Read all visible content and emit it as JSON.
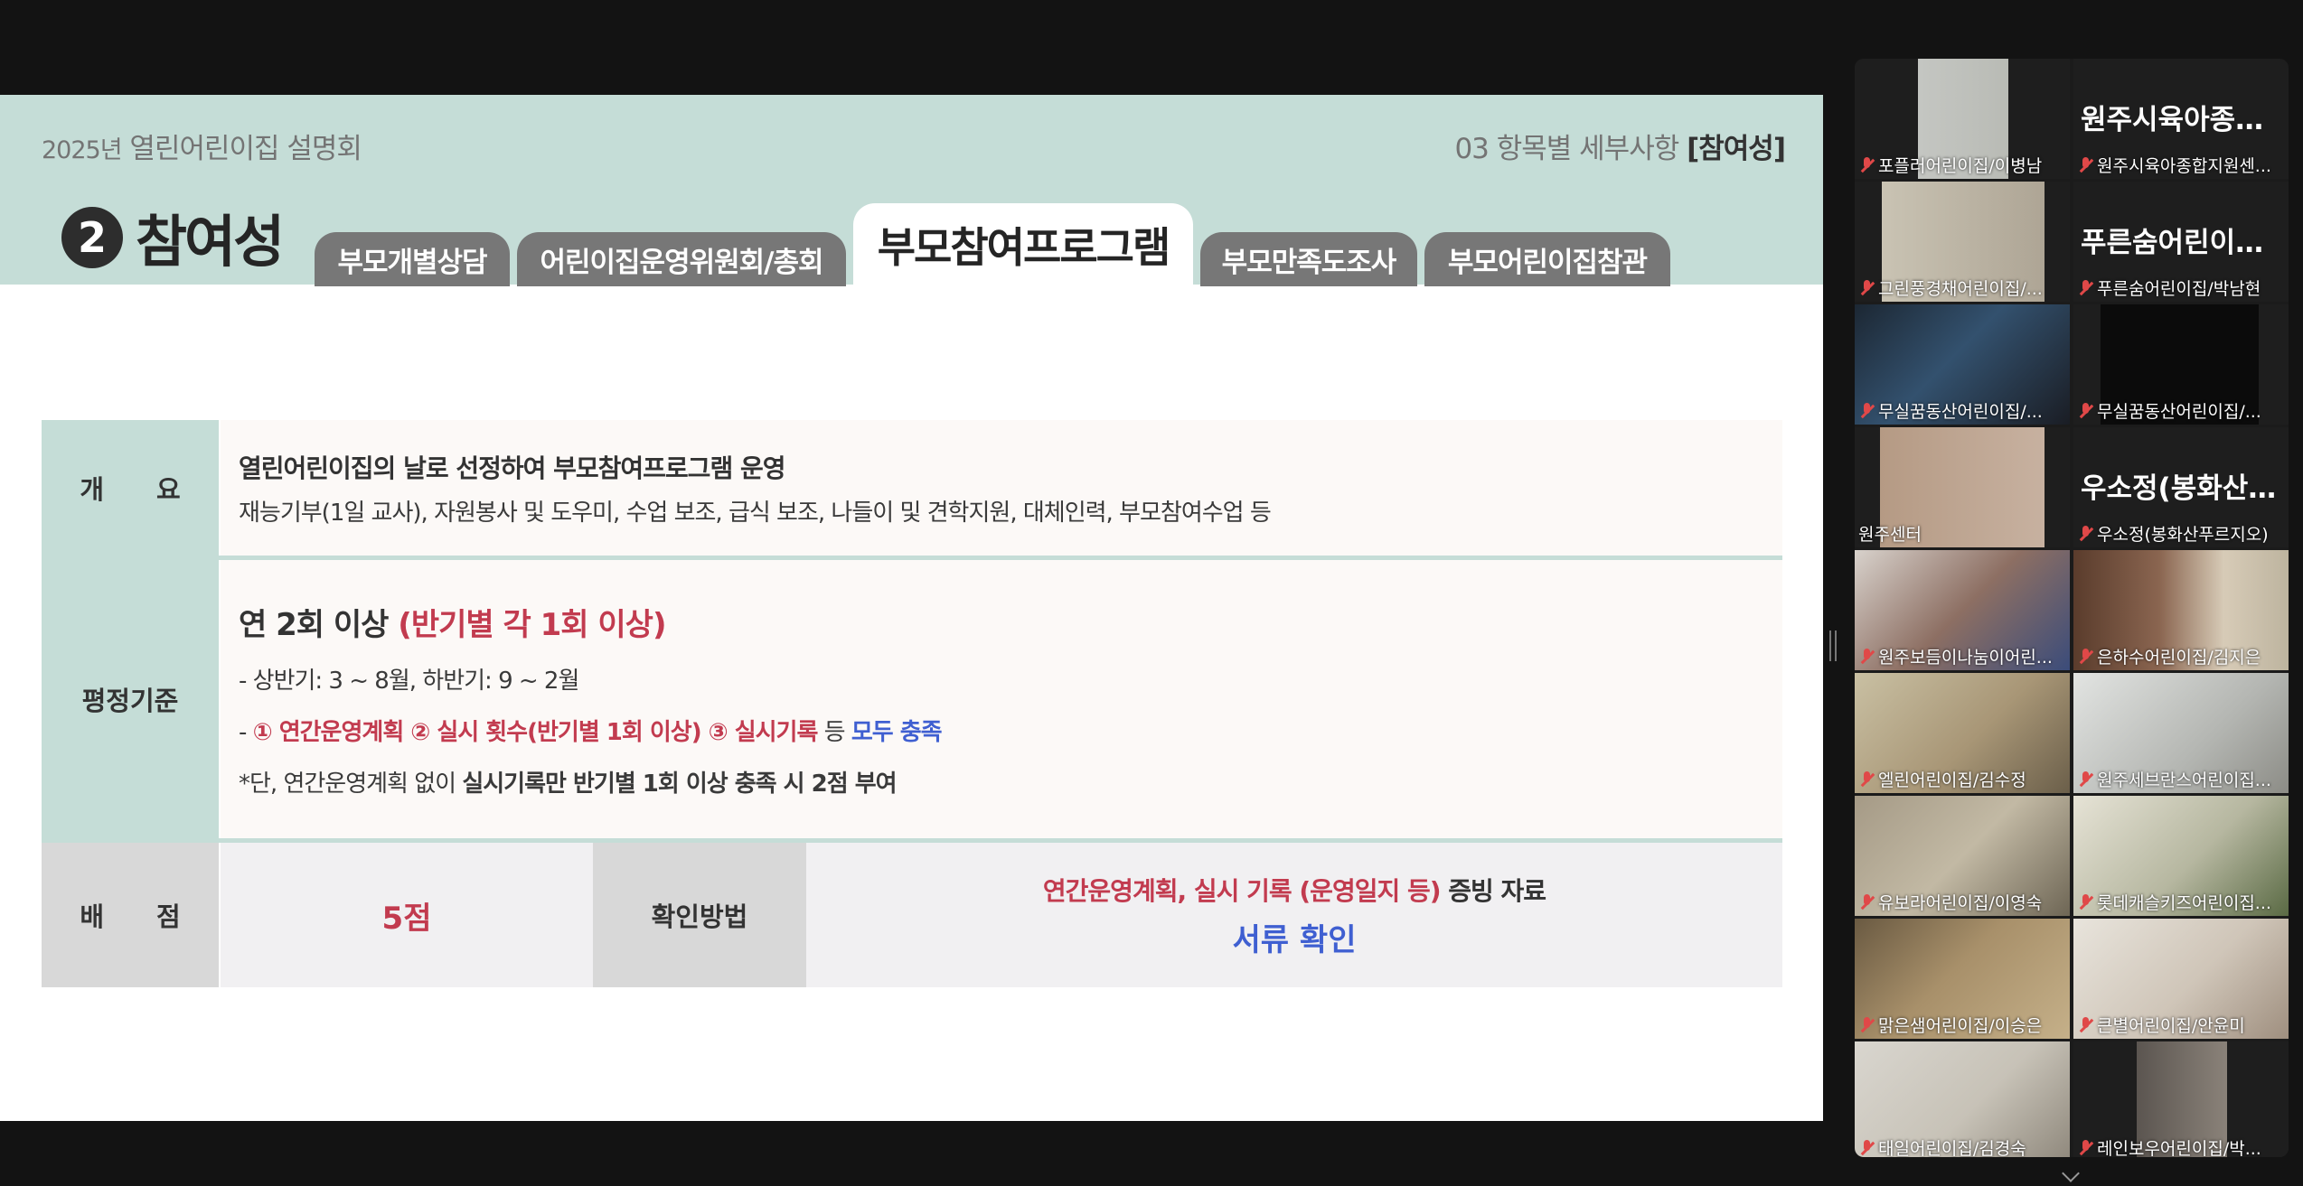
{
  "slide": {
    "event_year": "2025년",
    "event_name": "열린어린이집 설명회",
    "section_ref_prefix": "03 항목별 세부사항",
    "section_ref_bold": "[참여성]",
    "section_number": "2",
    "section_title": "참여성",
    "tabs": [
      {
        "label": "부모개별상담"
      },
      {
        "label": "어린이집운영위원회/총회"
      },
      {
        "label": "부모참여프로그램",
        "active": true
      },
      {
        "label": "부모만족도조사"
      },
      {
        "label": "부모어린이집참관"
      }
    ],
    "overview": {
      "label": "개　　요",
      "line1": "열린어린이집의 날로 선정하여 부모참여프로그램 운영",
      "line2": "재능기부(1일 교사), 자원봉사 및 도우미, 수업 보조, 급식 보조, 나들이 및 견학지원, 대체인력, 부모참여수업 등"
    },
    "criteria": {
      "label": "평정기준",
      "headline_a": "연 2회 이상 ",
      "headline_b": "(반기별 각 1회 이상)",
      "line1": "- 상반기: 3 ~ 8월, 하반기: 9 ~ 2월",
      "line2_a": "- ",
      "line2_b": "① 연간운영계획 ② 실시 횟수(반기별 1회 이상) ③ 실시기록",
      "line2_c": " 등 ",
      "line2_d": "모두 충족",
      "line3_a": "*단, 연간운영계획 없이 ",
      "line3_b": "실시기록만 반기별 1회 이상 충족 시 2점 부여"
    },
    "score": {
      "label": "배　　점",
      "value": "5점",
      "method_label": "확인방법",
      "method_a": "연간운영계획, 실시 기록 (운영일지 등)",
      "method_b": " 증빙 자료",
      "method_c": "서류 확인"
    }
  },
  "participants": [
    {
      "name": "포플러어린이집/이병남",
      "big": ""
    },
    {
      "name": "원주시육아종합지원센...",
      "big": "원주시육아종합..."
    },
    {
      "name": "그린풍경채어린이집/...",
      "big": ""
    },
    {
      "name": "푸른숨어린이집/박남현",
      "big": "푸른숨어린이집/..."
    },
    {
      "name": "무실꿈동산어린이집/...",
      "big": ""
    },
    {
      "name": "무실꿈동산어린이집/...",
      "big": ""
    },
    {
      "name": "원주센터",
      "big": "",
      "speaking": true
    },
    {
      "name": "우소정(봉화산푸르지오)",
      "big": "우소정(봉화산푸..."
    },
    {
      "name": "원주보듬이나눔이어린...",
      "big": ""
    },
    {
      "name": "은하수어린이집/김지은",
      "big": ""
    },
    {
      "name": "엘린어린이집/김수정",
      "big": ""
    },
    {
      "name": "원주세브란스어린이집...",
      "big": ""
    },
    {
      "name": "유보라어린이집/이영숙",
      "big": ""
    },
    {
      "name": "롯데캐슬키즈어린이집...",
      "big": ""
    },
    {
      "name": "맑은샘어린이집/이승은",
      "big": ""
    },
    {
      "name": "큰별어린이집/안윤미",
      "big": ""
    },
    {
      "name": "태일어린이집/김경숙",
      "big": ""
    },
    {
      "name": "레인보우어린이집/박...",
      "big": ""
    }
  ],
  "colors": {
    "slide_accent": "#c5ddd7",
    "highlight_red": "#c23b4f",
    "highlight_blue": "#3f5fd1",
    "speaker_outline": "#2ed69b",
    "muted_mic": "#e04848"
  },
  "icons": [
    "microphone-muted-icon",
    "panel-resize-handle-icon",
    "chevron-down-icon"
  ]
}
